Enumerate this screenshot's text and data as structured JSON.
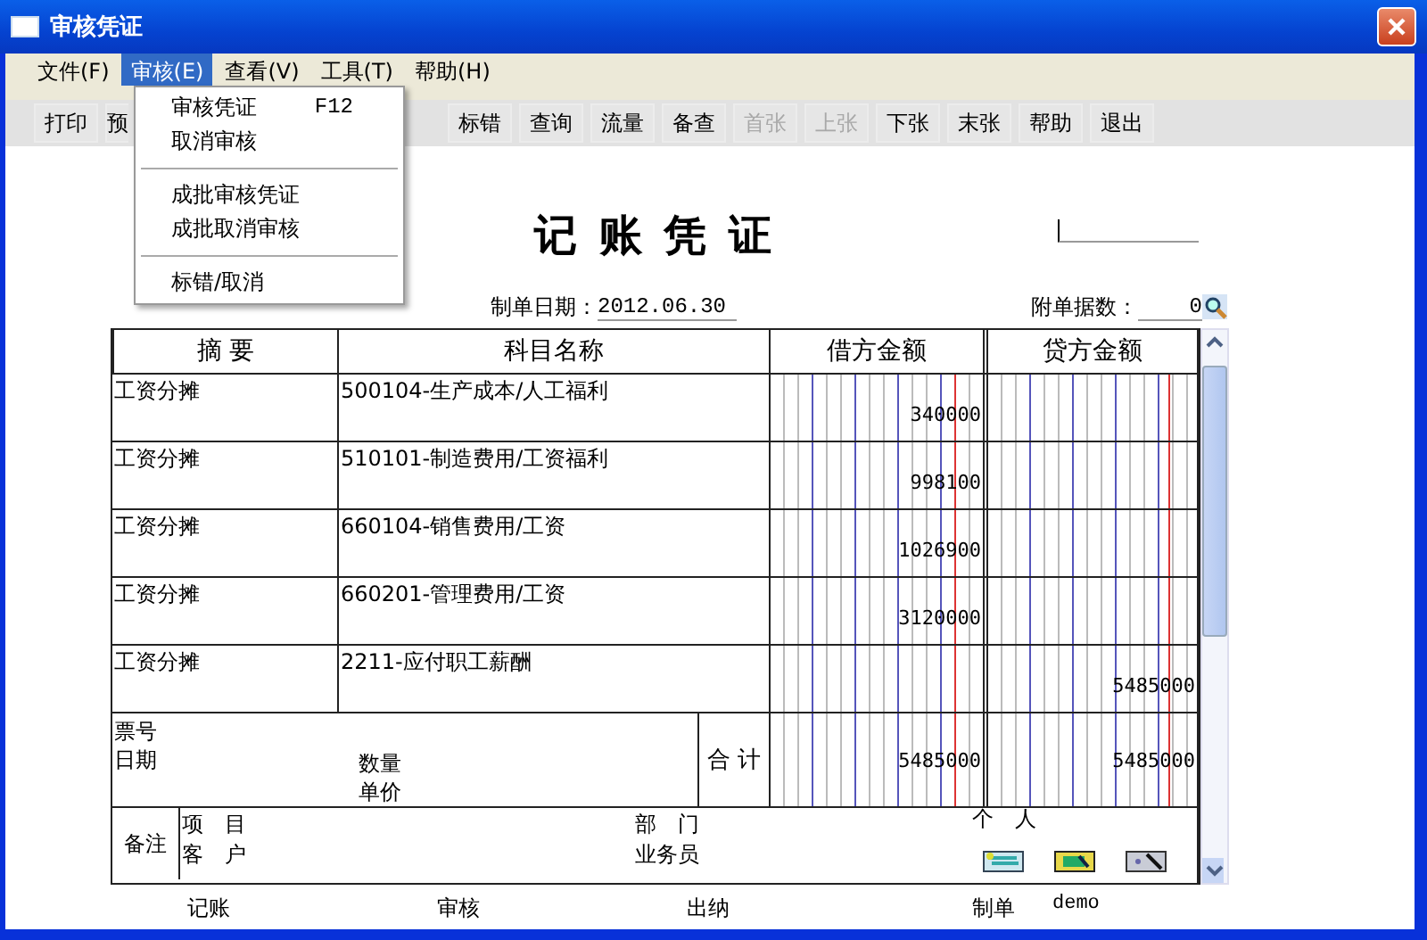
{
  "window": {
    "title": "审核凭证"
  },
  "menu_bar": [
    {
      "label": "文件(F)",
      "selected": false
    },
    {
      "label": "审核(E)",
      "selected": true
    },
    {
      "label": "查看(V)",
      "selected": false
    },
    {
      "label": "工具(T)",
      "selected": false
    },
    {
      "label": "帮助(H)",
      "selected": false
    }
  ],
  "toolbar": [
    {
      "label": "打印",
      "disabled": false
    },
    {
      "label": "预",
      "disabled": false
    },
    {
      "label": "标错",
      "disabled": false
    },
    {
      "label": "查询",
      "disabled": false
    },
    {
      "label": "流量",
      "disabled": false
    },
    {
      "label": "备查",
      "disabled": false
    },
    {
      "label": "首张",
      "disabled": true
    },
    {
      "label": "上张",
      "disabled": true
    },
    {
      "label": "下张",
      "disabled": false
    },
    {
      "label": "末张",
      "disabled": false
    },
    {
      "label": "帮助",
      "disabled": false
    },
    {
      "label": "退出",
      "disabled": false
    }
  ],
  "dropdown": [
    [
      {
        "label": "审核凭证",
        "shortcut": "F12"
      },
      {
        "label": "取消审核"
      }
    ],
    [
      {
        "label": "成批审核凭证"
      },
      {
        "label": "成批取消审核"
      }
    ],
    [
      {
        "label": "标错/取消"
      }
    ]
  ],
  "voucher": {
    "title": "记 账 凭 证",
    "date_label": "制单日期：",
    "date": "2012.06.30",
    "attachments_label": "附单据数：",
    "attachments": "0",
    "columns": [
      "摘 要",
      "科目名称",
      "借方金额",
      "贷方金额"
    ],
    "rows": [
      {
        "summary": "工资分摊",
        "account": "500104-生产成本/人工福利",
        "debit": "340000"
      },
      {
        "summary": "工资分摊",
        "account": "510101-制造费用/工资福利",
        "debit": "998100"
      },
      {
        "summary": "工资分摊",
        "account": "660104-销售费用/工资",
        "debit": "1026900"
      },
      {
        "summary": "工资分摊",
        "account": "660201-管理费用/工资",
        "debit": "3120000"
      },
      {
        "summary": "工资分摊",
        "account": "2211-应付职工薪酬",
        "credit": "5485000"
      }
    ],
    "ticket_label": "票号",
    "ticket_date_label": "日期",
    "quantity_label": "数量",
    "unit_price_label": "单价",
    "total_label": "合 计",
    "total_debit": "5485000",
    "total_credit": "5485000",
    "remark_label": "备注",
    "project_label": "项　目",
    "customer_label": "客　户",
    "department_label": "部　门",
    "salesperson_label": "业务员",
    "person_label": "个　人"
  },
  "footer": {
    "bookkeeper_label": "记账",
    "auditor_label": "审核",
    "cashier_label": "出纳",
    "preparer_label": "制单",
    "preparer": "demo"
  }
}
